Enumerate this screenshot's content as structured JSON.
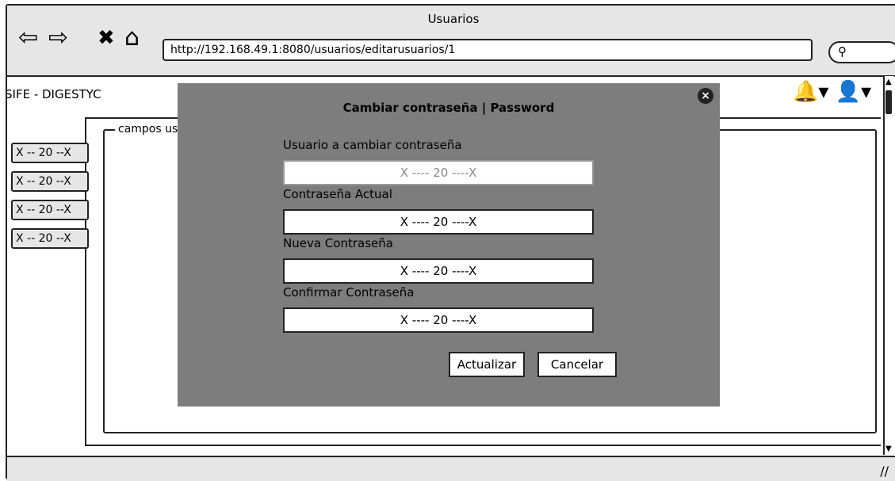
{
  "window": {
    "title": "Usuarios",
    "url": "http://192.168.49.1:8080/usuarios/editarusuarios/1",
    "nav_icons": [
      "back-arrow-icon",
      "forward-arrow-icon",
      "close-x-icon",
      "home-icon"
    ]
  },
  "app": {
    "title": "SIFE - DIGESTYC",
    "header_icons": [
      "bell-icon",
      "user-icon"
    ]
  },
  "sidebar": {
    "items": [
      {
        "label": "X -- 20 --X"
      },
      {
        "label": "X -- 20 --X"
      },
      {
        "label": "X -- 20 --X"
      },
      {
        "label": "X -- 20 --X"
      }
    ]
  },
  "fieldset": {
    "legend": "campos usuarios"
  },
  "modal": {
    "title": "Cambiar contraseña | Password",
    "fields": [
      {
        "label": "Usuario a cambiar contraseña",
        "value": "X ---- 20 ----X"
      },
      {
        "label": "Contraseña Actual",
        "value": "X ---- 20 ----X"
      },
      {
        "label": "Nueva Contraseña",
        "value": "X ---- 20 ----X"
      },
      {
        "label": "Confirmar Contraseña",
        "value": "X ---- 20 ----X"
      }
    ],
    "buttons": {
      "update": "Actualizar",
      "cancel": "Cancelar"
    }
  },
  "colors": {
    "overlay": "#7d7d7d",
    "chrome": "#e6e6e6"
  }
}
